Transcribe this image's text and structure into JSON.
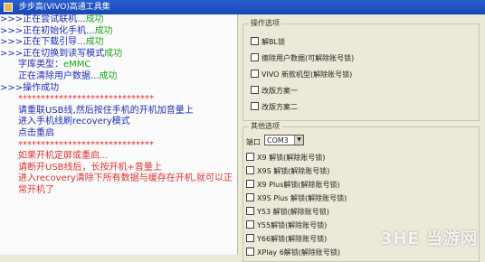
{
  "window": {
    "title": "步步高(VIVO)高通工具集"
  },
  "log": {
    "lines": [
      {
        "prefix": ">>>正在尝试联机...",
        "suffix": "成功"
      },
      {
        "prefix": ">>>正在初始化手机...",
        "suffix": "成功"
      },
      {
        "prefix": ">>>正在下载引导...",
        "suffix": "成功"
      },
      {
        "prefix": ">>>正在切换到读写模式",
        "suffix": "成功"
      }
    ],
    "storage_label": "字库类型：",
    "storage_value": "eMMC",
    "clearing_text": "正在清除用户数据...",
    "clearing_status": "成功",
    "op_success": ">>>操作成功",
    "separator1": "******************************",
    "instr1": "请重联USB线,然后按住手机的开机加音量上",
    "instr2": "进入手机线刷recovery模式",
    "instr3": "点击重启",
    "separator2": "******************************",
    "warn1": "如果开机定屏或重启...",
    "warn2": "请断开USB线后，长按开机+音量上",
    "warn3": "进入recovery清除下所有数据与缓存在开机,就可以正常开机了"
  },
  "ops": {
    "title": "操作选项",
    "items": [
      "解BL锁",
      "擦除用户数据(可解除账号锁)",
      "VIVO 新款机型(解除账号锁)",
      "改版方案一",
      "改版方案二"
    ]
  },
  "other": {
    "title": "其他选项",
    "port_label": "端口",
    "port_value": "COM3",
    "models": [
      "X9 解锁(解除账号锁)",
      "X9S 解锁(解除账号锁)",
      "X9 Plus解锁(解除账号锁)",
      "X9S Plus 解锁(解除账号锁)",
      "Y53 解锁(解除账号锁)",
      "Y55解锁(解除账号锁)",
      "Y66解锁(解除账号锁)",
      "XPlay 6解锁(解除账号锁)"
    ]
  },
  "watermark": "3HE 当游网"
}
